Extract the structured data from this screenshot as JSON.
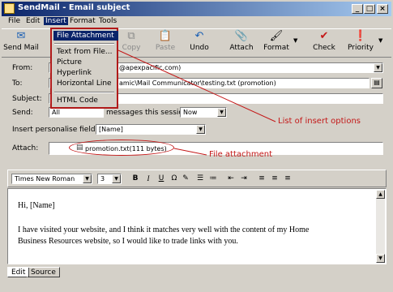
{
  "window": {
    "title": "SendMail - Email subject",
    "controls": [
      "_",
      "□",
      "×"
    ]
  },
  "menu": {
    "items": [
      "File",
      "Edit",
      "Insert",
      "Format",
      "Tools"
    ]
  },
  "toolbar": {
    "send": "Send Mail",
    "copy": "Copy",
    "paste": "Paste",
    "undo": "Undo",
    "attach": "Attach",
    "format": "Format",
    "check": "Check",
    "priority": "Priority"
  },
  "insert_menu": {
    "items": [
      "File Attachment",
      "Text from File...",
      "Picture",
      "Hyperlink",
      "Horizontal Line",
      "HTML Code"
    ]
  },
  "form": {
    "from_label": "From:",
    "from_value": "@apexpacific.com)",
    "to_label": "To:",
    "to_value": "amic\\Mail Communicator\\testing.txt (promotion)",
    "subject_label": "Subject:",
    "send_label": "Send:",
    "send_value": "All",
    "session_text": "messages this session",
    "session_value": "Now",
    "personalise_label": "Insert personalise field:",
    "personalise_value": "[Name]",
    "attach_label": "Attach:",
    "attach_value": "promotion.txt(111 bytes)"
  },
  "format_bar": {
    "font": "Times New Roman",
    "size": "3"
  },
  "editor": {
    "line1": "Hi, [Name]",
    "line2": "I have visited your website, and I think it matches very well with the content of my Home",
    "line3": "Business Resources website, so I would like to trade links with you."
  },
  "tabs": {
    "edit": "Edit",
    "source": "Source"
  },
  "annotations": {
    "insert_options": "List of insert options",
    "file_attachment": "File attachment"
  }
}
